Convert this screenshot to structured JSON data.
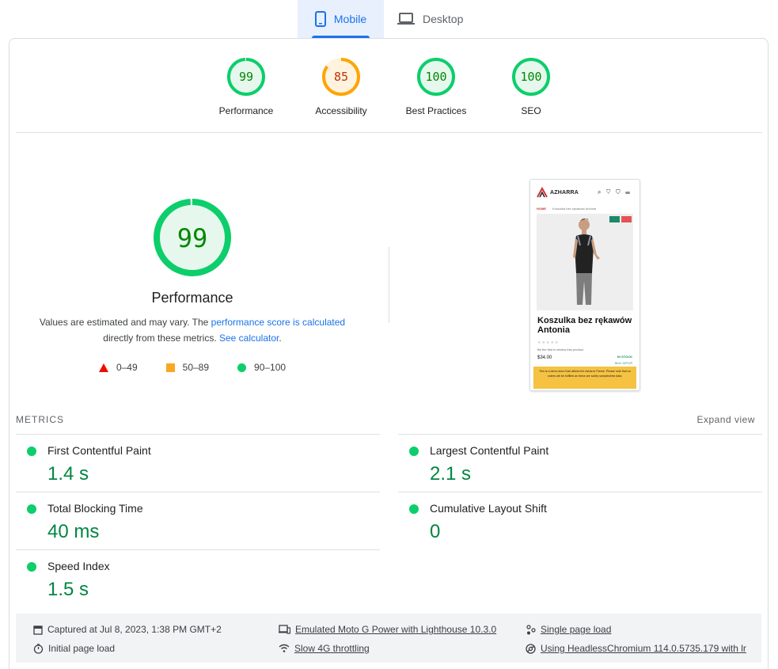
{
  "tabs": [
    {
      "label": "Mobile",
      "icon": "smartphone-icon",
      "active": true
    },
    {
      "label": "Desktop",
      "icon": "laptop-icon",
      "active": false
    }
  ],
  "categories": [
    {
      "label": "Performance",
      "score": "99",
      "color": "#0cce6b",
      "text_color": "#008800",
      "fraction": 0.99
    },
    {
      "label": "Accessibility",
      "score": "85",
      "color": "#ffa400",
      "text_color": "#c33300",
      "fraction": 0.85
    },
    {
      "label": "Best Practices",
      "score": "100",
      "color": "#0cce6b",
      "text_color": "#008800",
      "fraction": 1.0
    },
    {
      "label": "SEO",
      "score": "100",
      "color": "#0cce6b",
      "text_color": "#008800",
      "fraction": 1.0
    }
  ],
  "performance": {
    "score": "99",
    "title": "Performance",
    "desc_prefix": "Values are estimated and may vary. The ",
    "desc_link1": "performance score is calculated",
    "desc_middle": " directly from these metrics. ",
    "desc_link2": "See calculator",
    "desc_suffix": ".",
    "legend": [
      {
        "range": "0–49",
        "shape": "triangle",
        "color": "#eb0f00"
      },
      {
        "range": "50–89",
        "shape": "square",
        "color": "#f9a825"
      },
      {
        "range": "90–100",
        "shape": "circle",
        "color": "#0cce6b"
      }
    ]
  },
  "screenshot": {
    "logo": "AZHARRA",
    "icons": "⌕ ♡ ⛉ ☰",
    "breadcrumb_home": "HOME",
    "breadcrumb_item": "Koszulka bez rękawów Antonia",
    "title": "Koszulka bez rękawów Antonia",
    "stars": "★★★★★",
    "review": "Be the first to review this product",
    "stock": "IN STOCK",
    "price": "$34.00",
    "sku": "SKU: WTCR",
    "notice": "This is a demo store that utilizes the Azharra Theme. Please note that no orders will be fulfilled as these are solely samples/test data."
  },
  "metrics": {
    "header": "METRICS",
    "expand": "Expand view",
    "items": [
      {
        "name": "First Contentful Paint",
        "value": "1.4 s"
      },
      {
        "name": "Largest Contentful Paint",
        "value": "2.1 s"
      },
      {
        "name": "Total Blocking Time",
        "value": "40 ms"
      },
      {
        "name": "Cumulative Layout Shift",
        "value": "0"
      },
      {
        "name": "Speed Index",
        "value": "1.5 s"
      }
    ]
  },
  "footer": {
    "captured": "Captured at Jul 8, 2023, 1:38 PM GMT+2",
    "initial_load": "Initial page load",
    "emulated": "Emulated Moto G Power with Lighthouse 10.3.0",
    "throttling": "Slow 4G throttling",
    "single_page": "Single page load",
    "browser": "Using HeadlessChromium 114.0.5735.179 with lr"
  }
}
